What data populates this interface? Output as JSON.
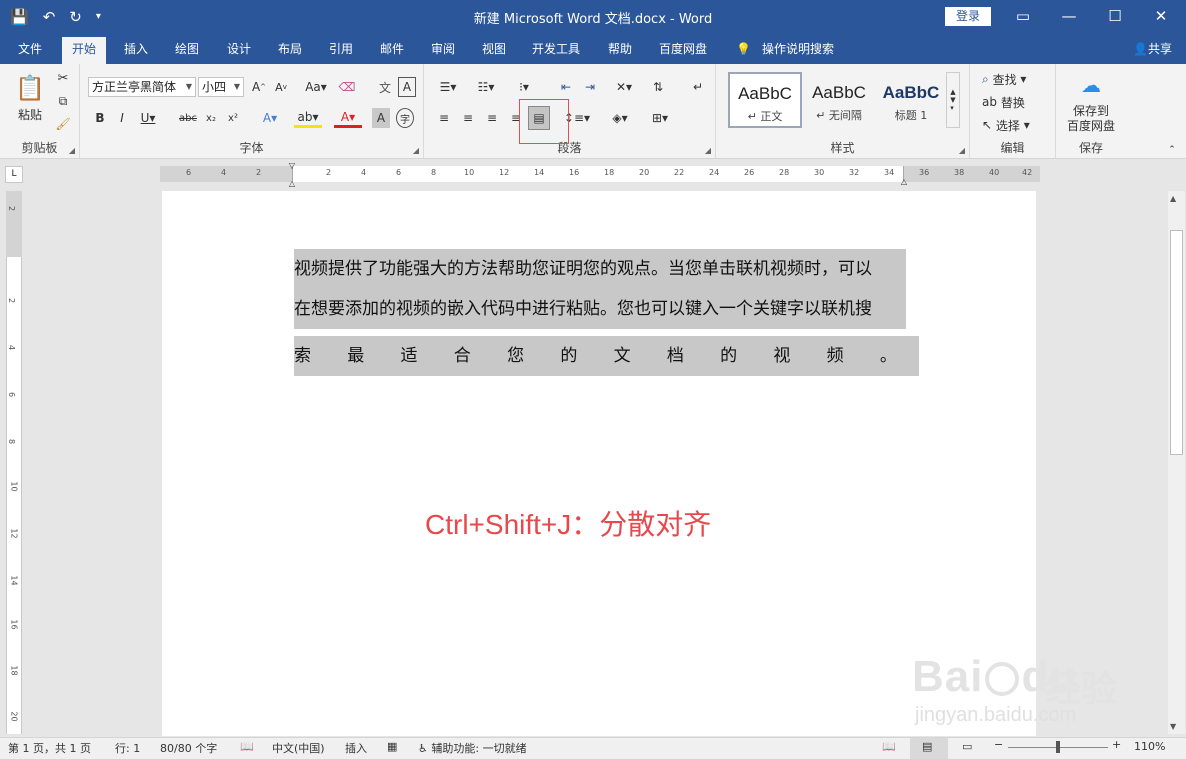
{
  "titlebar": {
    "title": "新建 Microsoft Word 文档.docx  -  Word",
    "login": "登录",
    "icons": {
      "save": "save-icon",
      "undo": "undo-icon",
      "redo": "redo-icon",
      "customize": "customize-qat-icon"
    }
  },
  "menu": {
    "tabs": [
      "文件",
      "开始",
      "插入",
      "绘图",
      "设计",
      "布局",
      "引用",
      "邮件",
      "审阅",
      "视图",
      "开发工具",
      "帮助",
      "百度网盘"
    ],
    "active": "开始",
    "tell_me": "操作说明搜索",
    "share": "共享"
  },
  "ribbon": {
    "clipboard": {
      "paste": "粘贴",
      "label": "剪贴板"
    },
    "font": {
      "font_name": "方正兰亭黑简体",
      "font_size": "小四",
      "label": "字体"
    },
    "paragraph": {
      "label": "段落"
    },
    "styles": {
      "label": "样式",
      "items": [
        {
          "sample": "AaBbC",
          "name": "↵ 正文"
        },
        {
          "sample": "AaBbC",
          "name": "↵ 无间隔"
        },
        {
          "sample": "AaBbC",
          "name": "标题 1"
        }
      ]
    },
    "editing": {
      "find": "查找",
      "replace": "替换",
      "select": "选择",
      "label": "编辑"
    },
    "save": {
      "line1": "保存到",
      "line2": "百度网盘",
      "label": "保存"
    }
  },
  "ruler": {
    "h_ticks": [
      "6",
      "4",
      "2",
      "2",
      "4",
      "6",
      "8",
      "10",
      "12",
      "14",
      "16",
      "18",
      "20",
      "22",
      "24",
      "26",
      "28",
      "30",
      "32",
      "34",
      "36",
      "38",
      "40",
      "42"
    ],
    "v_ticks": [
      "2",
      "2",
      "4",
      "6",
      "8",
      "10",
      "12",
      "14",
      "16",
      "18",
      "20"
    ]
  },
  "document": {
    "line1": "视频提供了功能强大的方法帮助您证明您的观点。当您单击联机视频时，可以",
    "line2": "在想要添加的视频的嵌入代码中进行粘贴。您也可以键入一个关键字以联机搜",
    "line3_chars": [
      "索",
      "最",
      "适",
      "合",
      "您",
      "的",
      "文",
      "档",
      "的",
      "视",
      "频",
      "。"
    ],
    "annotation": "Ctrl+Shift+J：分散对齐"
  },
  "watermark": {
    "brand": "Bai",
    "brand2": "du",
    "cn": "经验",
    "url": "jingyan.baidu.com"
  },
  "status": {
    "page": "第 1 页，共 1 页",
    "line": "行: 1",
    "words": "80/80 个字",
    "language": "中文(中国)",
    "mode": "插入",
    "accessibility": "辅助功能: 一切就绪",
    "zoom": "110%"
  }
}
